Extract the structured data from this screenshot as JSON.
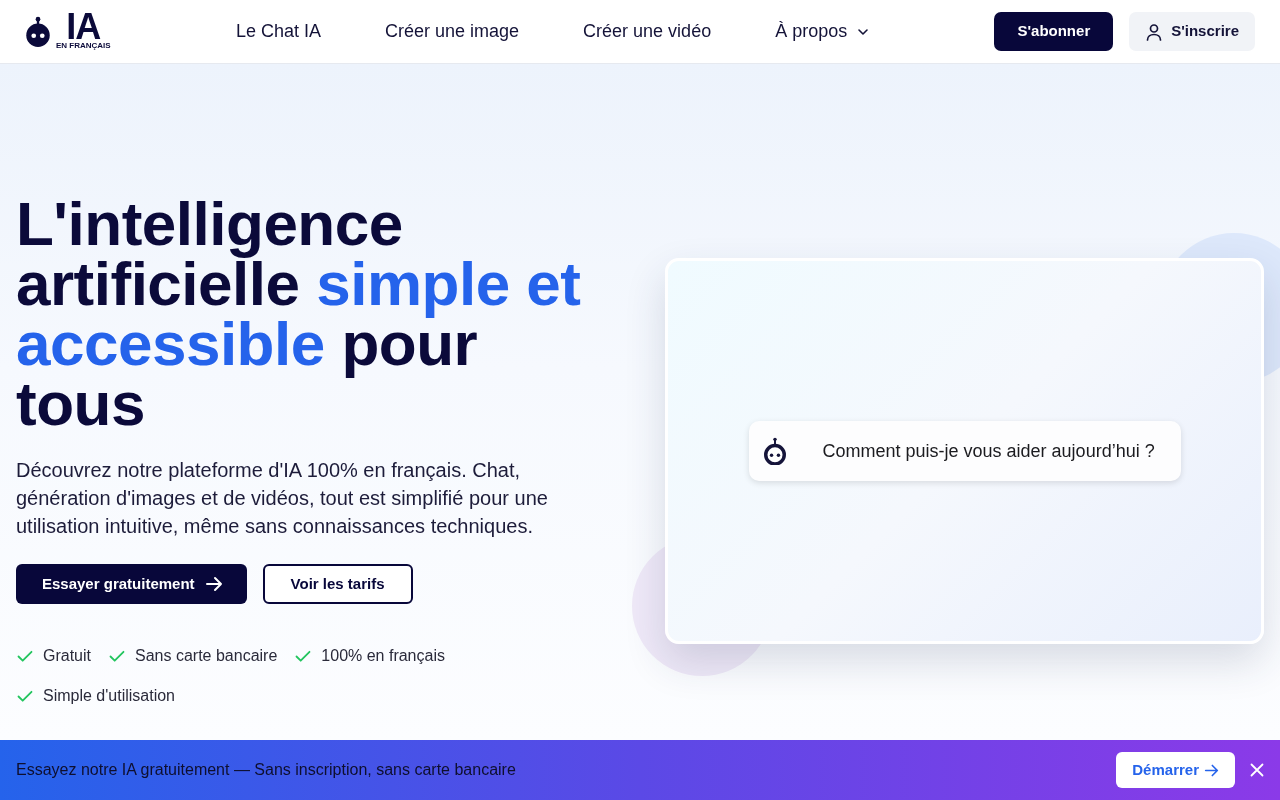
{
  "logo": {
    "wordmark": "IA",
    "tagline": "EN FRANÇAIS"
  },
  "nav": {
    "links": [
      {
        "label": "Le Chat IA",
        "kind": "link"
      },
      {
        "label": "Créer une image",
        "kind": "link"
      },
      {
        "label": "Créer une vidéo",
        "kind": "link"
      },
      {
        "label": "À propos",
        "kind": "dropdown"
      }
    ],
    "actions": [
      {
        "label": "S'abonner",
        "kind": "primary"
      },
      {
        "label": "S'inscrire",
        "kind": "account"
      }
    ]
  },
  "hero": {
    "headline": [
      {
        "text": "L'intelligence artificielle ",
        "highlight": false
      },
      {
        "text": "simple et accessible",
        "highlight": true
      },
      {
        "text": " pour tous",
        "highlight": false
      }
    ],
    "description": "Découvrez notre plateforme d'IA 100% en français. Chat, génération d'images et de vidéos, tout est simplifié pour une utilisation intuitive, même sans connaissances techniques.",
    "buttons": [
      {
        "label": "Essayer gratuitement",
        "kind": "primary"
      },
      {
        "label": "Voir les tarifs",
        "kind": "outline"
      }
    ],
    "features": [
      "Gratuit",
      "Sans carte bancaire",
      "100% en français",
      "Simple d'utilisation"
    ]
  },
  "preview": {
    "message": "Comment puis-je vous aider aujourd’hui ?"
  },
  "banner": {
    "text": "Essayez notre IA gratuitement — Sans inscription, sans carte bancaire",
    "button": "Démarrer"
  }
}
